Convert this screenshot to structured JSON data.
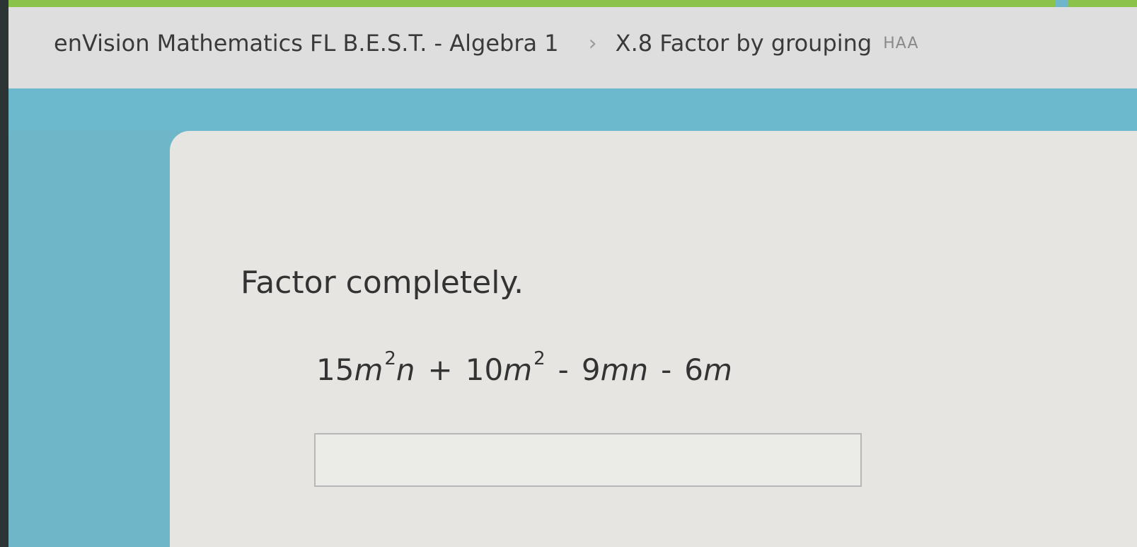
{
  "header": {
    "course": "enVision Mathematics FL B.E.S.T. - Algebra 1",
    "separator": "›",
    "skill": "X.8 Factor by grouping",
    "skill_code": "HAA"
  },
  "question": {
    "prompt": "Factor completely.",
    "expression": {
      "t1_coef": "15",
      "t1_var1": "m",
      "t1_exp": "2",
      "t1_var2": "n",
      "op1": "+",
      "t2_coef": "10",
      "t2_var": "m",
      "t2_exp": "2",
      "op2": "-",
      "t3_coef": "9",
      "t3_var": "mn",
      "op3": "-",
      "t4_coef": "6",
      "t4_var": "m"
    },
    "answer_value": ""
  },
  "colors": {
    "background": "#6fb6c8",
    "header_bg": "#dedede",
    "card_bg": "#e6e5e1",
    "accent_green": "#8bc34a"
  }
}
